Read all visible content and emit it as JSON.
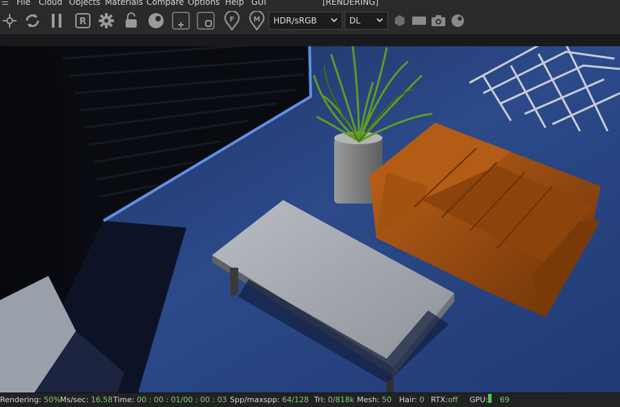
{
  "menu": {
    "items": [
      "File",
      "Cloud",
      "Objects",
      "Materials",
      "Compare",
      "Options",
      "Help",
      "GUI"
    ],
    "rendering_title": "[RENDERING]"
  },
  "toolbar": {
    "tone_mapping": "HDR/sRGB",
    "kernel": "DL",
    "icons": [
      "home-icon",
      "pin-icon",
      "refresh-icon",
      "pause-icon",
      "region-icon",
      "gear-icon",
      "lock-icon",
      "sphere-icon",
      "add-region-icon",
      "film-region-icon",
      "focus-pick-icon",
      "material-pick-icon",
      "cube-icon",
      "film-icon",
      "camera-icon",
      "material-ball-icon"
    ]
  },
  "status": {
    "rendering_label": "Rendering:",
    "rendering_value": "50%",
    "ms_label": "Ms/sec:",
    "ms_value": "16.58",
    "time_label": "Time:",
    "time_value": "00 : 00 : 01/00 : 00 : 03",
    "spp_label": "Spp/maxspp:",
    "spp_value": "64/128",
    "tri_label": "Tri:",
    "tri_value": "0/818k",
    "mesh_label": "Mesh:",
    "mesh_value": "50",
    "hair_label": "Hair:",
    "hair_value": "0",
    "rtx_label": "RTX:",
    "rtx_value": "off",
    "gpu_label": "GPU:",
    "gpu_value": "69"
  },
  "colors": {
    "accent_green": "#7ed36b",
    "sofa": "#a4520f",
    "floor": "#2c4a8a"
  }
}
